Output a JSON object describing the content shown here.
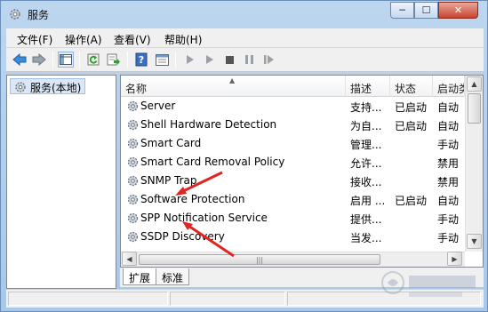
{
  "window": {
    "title": "服务",
    "close_glyph": "✕",
    "min_glyph": "─",
    "max_glyph": "☐"
  },
  "menu": [
    {
      "label": "文件(F)"
    },
    {
      "label": "操作(A)"
    },
    {
      "label": "查看(V)"
    },
    {
      "label": "帮助(H)"
    }
  ],
  "toolbar": {
    "icons": [
      "back-arrow-icon",
      "forward-arrow-icon",
      "console-tree-icon",
      "refresh-icon",
      "export-list-icon",
      "help-icon",
      "properties-icon",
      "start-service-icon",
      "start-service-alt-icon",
      "stop-service-icon",
      "pause-service-icon",
      "restart-service-icon"
    ]
  },
  "tree": {
    "label": "服务(本地)"
  },
  "columns": {
    "name": "名称",
    "description": "描述",
    "status": "状态",
    "startup": "启动类"
  },
  "rows": [
    {
      "name": "Server",
      "description": "支持...",
      "status": "已启动",
      "startup": "自动"
    },
    {
      "name": "Shell Hardware Detection",
      "description": "为自...",
      "status": "已启动",
      "startup": "自动"
    },
    {
      "name": "Smart Card",
      "description": "管理...",
      "status": "",
      "startup": "手动"
    },
    {
      "name": "Smart Card Removal Policy",
      "description": "允许...",
      "status": "",
      "startup": "禁用"
    },
    {
      "name": "SNMP Trap",
      "description": "接收...",
      "status": "",
      "startup": "禁用"
    },
    {
      "name": "Software Protection",
      "description": "启用 ...",
      "status": "已启动",
      "startup": "自动"
    },
    {
      "name": "SPP Notification Service",
      "description": "提供...",
      "status": "",
      "startup": "手动"
    },
    {
      "name": "SSDP Discovery",
      "description": "当发...",
      "status": "",
      "startup": "手动"
    }
  ],
  "tabs": [
    {
      "label": "扩展"
    },
    {
      "label": "标准"
    }
  ],
  "colors": {
    "annotation_arrow": "#e02424",
    "selected_tree_bg": "#dbe7f6"
  }
}
